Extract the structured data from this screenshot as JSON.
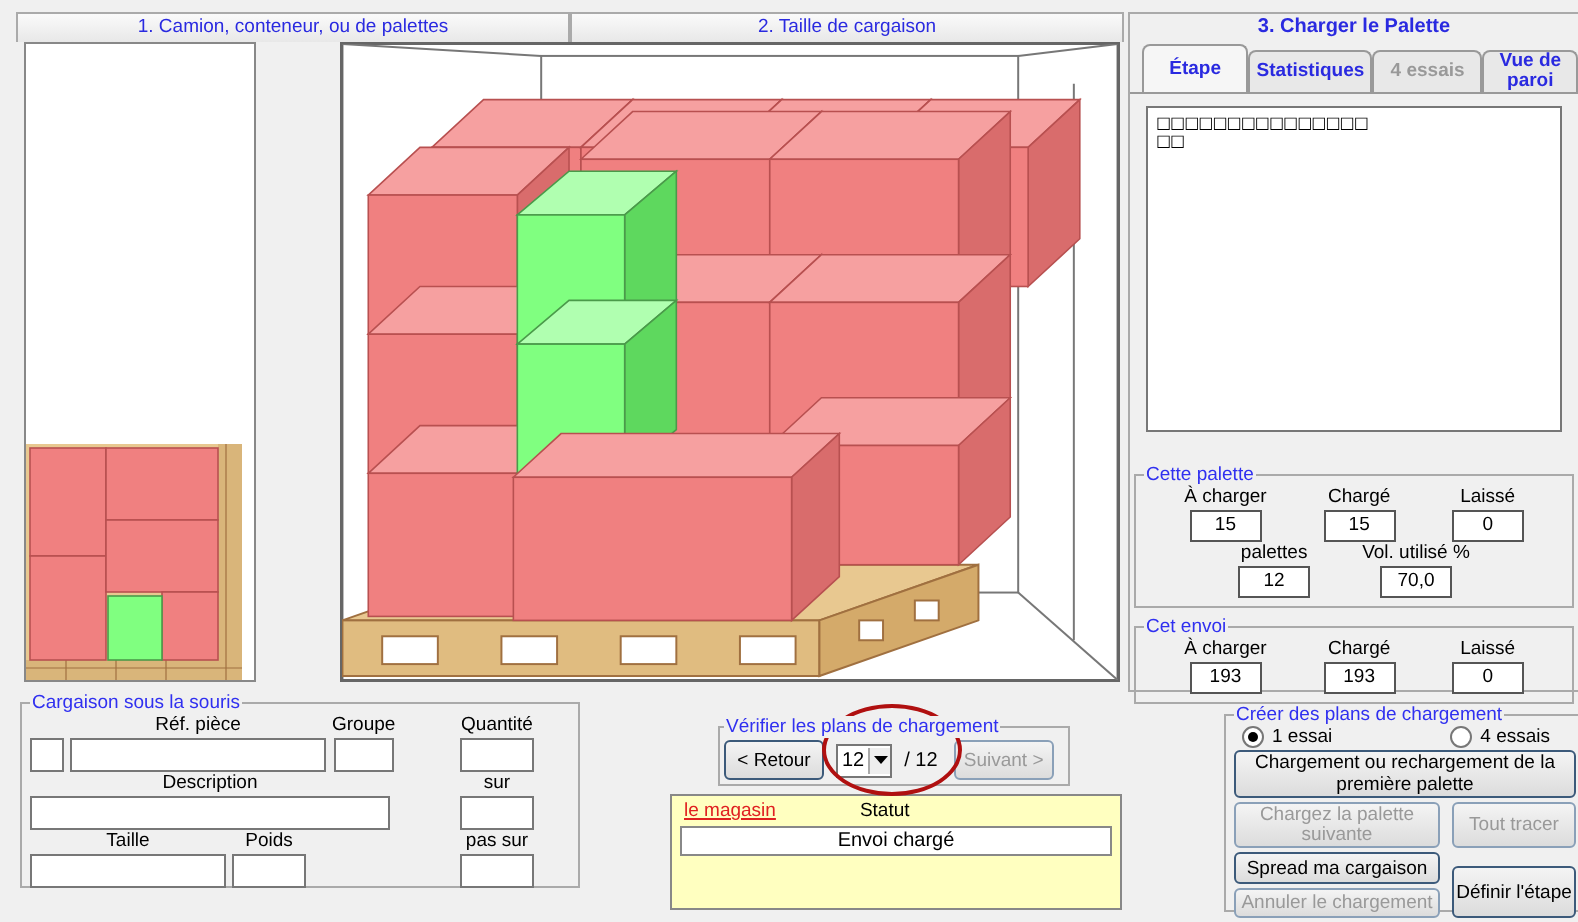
{
  "sections": [
    {
      "label": "1. Camion, conteneur, ou de palettes"
    },
    {
      "label": "2. Taille de cargaison"
    }
  ],
  "load_panel": {
    "title": "3. Charger le Palette",
    "tabs": [
      {
        "label": "Étape",
        "selected": true,
        "disabled": false
      },
      {
        "label": "Statistiques",
        "selected": false,
        "disabled": false
      },
      {
        "label": "4 essais",
        "selected": false,
        "disabled": true
      },
      {
        "label": "Vue de paroi",
        "selected": false,
        "disabled": false
      }
    ],
    "step_list": [
      "□□□□□□□□□□□□□□□",
      "□□"
    ],
    "this_pallet": {
      "title": "Cette palette",
      "rows": [
        [
          {
            "label": "À charger",
            "value": "15"
          },
          {
            "label": "Chargé",
            "value": "15"
          },
          {
            "label": "Laissé",
            "value": "0"
          }
        ],
        [
          {
            "label": "palettes",
            "value": "12"
          },
          {
            "label": "Vol. utilisé %",
            "value": "70,0"
          }
        ]
      ]
    },
    "this_shipment": {
      "title": "Cet envoi",
      "rows": [
        [
          {
            "label": "À charger",
            "value": "193"
          },
          {
            "label": "Chargé",
            "value": "193"
          },
          {
            "label": "Laissé",
            "value": "0"
          }
        ]
      ]
    }
  },
  "cargo_under_mouse": {
    "title": "Cargaison sous la souris",
    "rows": [
      {
        "fields": [
          {
            "kind": "unlabeled"
          },
          {
            "kind": "labeled",
            "label": "Réf. pièce"
          },
          {
            "kind": "labeled",
            "label": "Groupe"
          }
        ],
        "side": {
          "label": "Quantité"
        }
      },
      {
        "fields": [
          {
            "kind": "labeled",
            "label": "Description"
          }
        ],
        "side": {
          "label": "sur"
        }
      },
      {
        "fields": [
          {
            "kind": "labeled",
            "label": "Taille"
          },
          {
            "kind": "labeled",
            "label": "Poids"
          }
        ],
        "side": {
          "label": "pas sur"
        }
      }
    ]
  },
  "verify": {
    "title": "Vérifier les plans de chargement",
    "back": {
      "label": "< Retour",
      "disabled": false
    },
    "page": "12",
    "total": "/ 12",
    "next": {
      "label": "Suivant >",
      "disabled": true
    }
  },
  "status": {
    "link": "le magasin",
    "label": "Statut",
    "value": "Envoi chargé"
  },
  "create": {
    "title": "Créer des plans de chargement",
    "radios": [
      {
        "label": "1 essai",
        "selected": true
      },
      {
        "label": "4 essais",
        "selected": false
      }
    ],
    "buttons": [
      {
        "label": "Chargement ou rechargement de la première palette",
        "disabled": false
      },
      {
        "label": "Chargez la palette suivante",
        "disabled": true
      },
      {
        "label": "Tout tracer",
        "disabled": true
      },
      {
        "label": "Spread ma cargaison",
        "disabled": false
      },
      {
        "label": "Définir l'étape",
        "disabled": false
      },
      {
        "label": "Annuler le chargement",
        "disabled": true
      }
    ]
  }
}
